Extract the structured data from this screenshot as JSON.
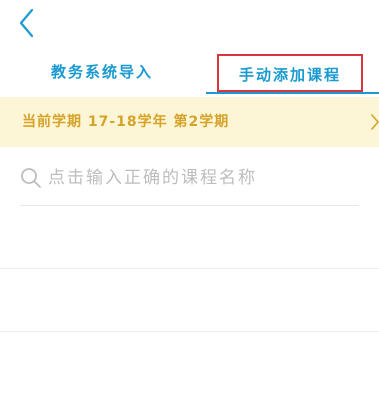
{
  "nav": {
    "back_icon": "chevron-left-icon"
  },
  "tabs": [
    {
      "label": "教务系统导入"
    },
    {
      "label": "手动添加课程"
    }
  ],
  "term_bar": {
    "label": "当前学期 17-18学年 第2学期",
    "chevron_icon": "chevron-right-icon"
  },
  "search": {
    "icon": "search-icon",
    "placeholder": "点击输入正确的课程名称",
    "value": ""
  },
  "colors": {
    "accent": "#1a9ad0",
    "highlight_border": "#d6363c",
    "term_background": "#fdf6d6",
    "term_text": "#d5a32a",
    "placeholder": "#bdbdbd"
  }
}
